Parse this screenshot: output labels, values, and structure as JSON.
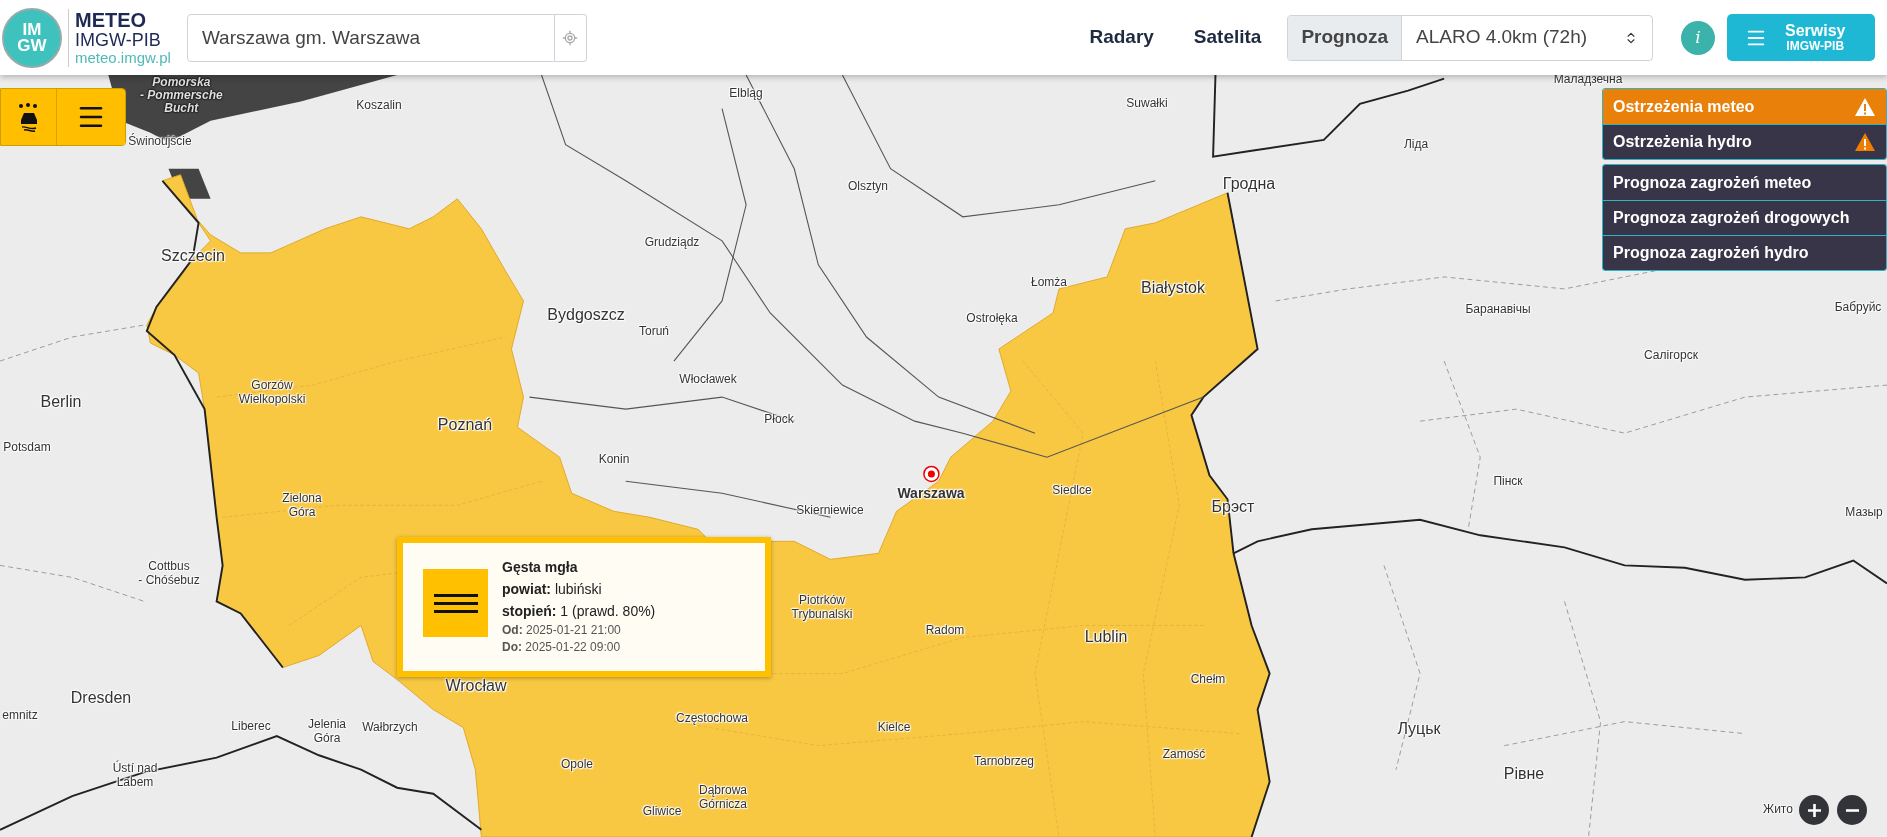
{
  "header": {
    "logo": {
      "mark_lines": [
        "IM",
        "GW"
      ],
      "title": "METEO",
      "subtitle": "IMGW-PIB",
      "url": "meteo.imgw.pl"
    },
    "search": {
      "value": "Warszawa gm. Warszawa"
    },
    "nav": [
      {
        "label": "Radary"
      },
      {
        "label": "Satelita"
      }
    ],
    "forecast": {
      "label": "Prognoza",
      "model": "ALARO 4.0km (72h)"
    },
    "info_button": {
      "label": "i"
    },
    "services_button": {
      "label": "Serwisy",
      "sublabel": "IMGW-PIB"
    }
  },
  "map": {
    "sea_label": "Pomorska\n- Pommersche\nBucht",
    "places": [
      {
        "name": "Маладзечна",
        "kind": "town"
      },
      {
        "name": "Elbląg",
        "kind": "town"
      },
      {
        "name": "Koszalin",
        "kind": "town"
      },
      {
        "name": "Suwałki",
        "kind": "town"
      },
      {
        "name": "Świnoujście",
        "kind": "town"
      },
      {
        "name": "Лiда",
        "kind": "town"
      },
      {
        "name": "Гродна",
        "kind": "city"
      },
      {
        "name": "Olsztyn",
        "kind": "town"
      },
      {
        "name": "Grudziądz",
        "kind": "town"
      },
      {
        "name": "Szczecin",
        "kind": "city"
      },
      {
        "name": "Łomża",
        "kind": "town"
      },
      {
        "name": "Białystok",
        "kind": "city"
      },
      {
        "name": "Баранавiчы",
        "kind": "town"
      },
      {
        "name": "Бабруйс",
        "kind": "town"
      },
      {
        "name": "Bydgoszcz",
        "kind": "city"
      },
      {
        "name": "Ostrołęka",
        "kind": "town"
      },
      {
        "name": "Toruń",
        "kind": "town"
      },
      {
        "name": "Салiгорск",
        "kind": "town"
      },
      {
        "name": "Włocławek",
        "kind": "town"
      },
      {
        "name": "Berlin",
        "kind": "city"
      },
      {
        "name": "Gorzów\nWielkopolski",
        "kind": "town"
      },
      {
        "name": "Płock",
        "kind": "town"
      },
      {
        "name": "Poznań",
        "kind": "city"
      },
      {
        "name": "Potsdam",
        "kind": "town"
      },
      {
        "name": "Konin",
        "kind": "town"
      },
      {
        "name": "Warszawa",
        "kind": "pinned"
      },
      {
        "name": "Пiнск",
        "kind": "town"
      },
      {
        "name": "Siedlce",
        "kind": "town"
      },
      {
        "name": "Zielona\nGóra",
        "kind": "town"
      },
      {
        "name": "Skierniewice",
        "kind": "town"
      },
      {
        "name": "Брэст",
        "kind": "city"
      },
      {
        "name": "Мазыр",
        "kind": "town"
      },
      {
        "name": "Cottbus\n- Chóśebuz",
        "kind": "town"
      },
      {
        "name": "Piotrków\nTrybunalski",
        "kind": "town"
      },
      {
        "name": "Radom",
        "kind": "town"
      },
      {
        "name": "Lublin",
        "kind": "city"
      },
      {
        "name": "Chełm",
        "kind": "town"
      },
      {
        "name": "Wrocław",
        "kind": "city"
      },
      {
        "name": "Dresden",
        "kind": "city"
      },
      {
        "name": "emnitz",
        "kind": "town"
      },
      {
        "name": "Częstochowa",
        "kind": "town"
      },
      {
        "name": "Liberec",
        "kind": "town"
      },
      {
        "name": "Jelenia\nGóra",
        "kind": "town"
      },
      {
        "name": "Wałbrzych",
        "kind": "town"
      },
      {
        "name": "Kielce",
        "kind": "town"
      },
      {
        "name": "Луцьк",
        "kind": "city"
      },
      {
        "name": "Zamość",
        "kind": "town"
      },
      {
        "name": "Opole",
        "kind": "town"
      },
      {
        "name": "Tarnobrzeg",
        "kind": "town"
      },
      {
        "name": "Рiвне",
        "kind": "city"
      },
      {
        "name": "Ústí nad\nLabem",
        "kind": "town"
      },
      {
        "name": "Dąbrowa\nGórnicza",
        "kind": "town"
      },
      {
        "name": "Gliwice",
        "kind": "town"
      },
      {
        "name": "Жито",
        "kind": "town"
      }
    ]
  },
  "warning_popup": {
    "title": "Gęsta mgła",
    "rows": [
      {
        "label": "powiat:",
        "value": "lubiński"
      },
      {
        "label": "stopień:",
        "value": "1 (prawd. 80%)"
      }
    ],
    "period": [
      {
        "label": "Od:",
        "value": "2025-01-21 21:00"
      },
      {
        "label": "Do:",
        "value": "2025-01-22 09:00"
      }
    ]
  },
  "layers_menu": {
    "groups": [
      {
        "items": [
          {
            "label": "Ostrzeżenia meteo",
            "selected": true,
            "warning": true
          },
          {
            "label": "Ostrzeżenia hydro",
            "selected": false,
            "warning": true
          }
        ]
      },
      {
        "items": [
          {
            "label": "Prognoza zagrożeń meteo",
            "selected": false,
            "warning": false
          },
          {
            "label": "Prognoza zagrożeń drogowych",
            "selected": false,
            "warning": false
          },
          {
            "label": "Prognoza zagrożeń hydro",
            "selected": false,
            "warning": false
          }
        ]
      }
    ]
  }
}
